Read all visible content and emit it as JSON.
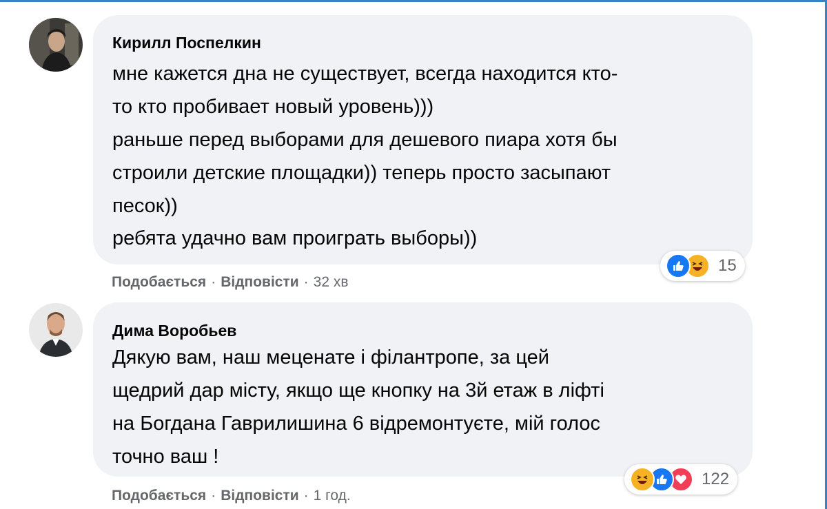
{
  "comments": [
    {
      "author": "Кирилл Поспелкин",
      "text": "мне кажется дна не существует, всегда находится кто-\nто кто пробивает новый уровень)))\nраньше перед выборами для дешевого пиара хотя бы\nстроили детские площадки)) теперь просто засыпают\nпесок))",
      "text2": "ребята удачно вам проиграть выборы))",
      "reactions": [
        "like-icon",
        "haha-icon"
      ],
      "reaction_count": "15",
      "like_label": "Подобається",
      "reply_label": "Відповісти",
      "time": "32 хв"
    },
    {
      "author": "Дима Воробьев",
      "text": "Дякую вам, наш меценате і філантропе, за цей\nщедрий дар місту, якщо ще кнопку на 3й етаж в ліфті\nна Богдана Гаврилишина 6 відремонтуєте, мій голос\nточно ваш !",
      "reactions": [
        "haha-icon",
        "like-icon",
        "love-icon"
      ],
      "reaction_count": "122",
      "like_label": "Подобається",
      "reply_label": "Відповісти",
      "time": "1 год."
    }
  ],
  "separator": "·",
  "colors": {
    "like": "#1877f2",
    "haha": "#f7b125",
    "love": "#f33e58",
    "bubble": "#f0f2f5",
    "frame": "#3b83c5"
  }
}
